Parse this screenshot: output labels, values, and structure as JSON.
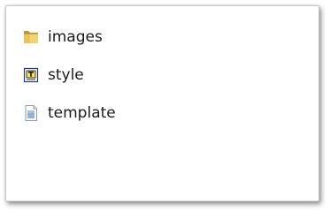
{
  "files": [
    {
      "name": "images",
      "icon": "folder-icon"
    },
    {
      "name": "style",
      "icon": "text-document-icon"
    },
    {
      "name": "template",
      "icon": "generic-file-icon"
    }
  ],
  "colors": {
    "folder_yellow": "#e9c45a",
    "folder_dark": "#c7962a",
    "text_icon_yellow": "#f6e24a",
    "file_blue": "#7fa6c9"
  }
}
